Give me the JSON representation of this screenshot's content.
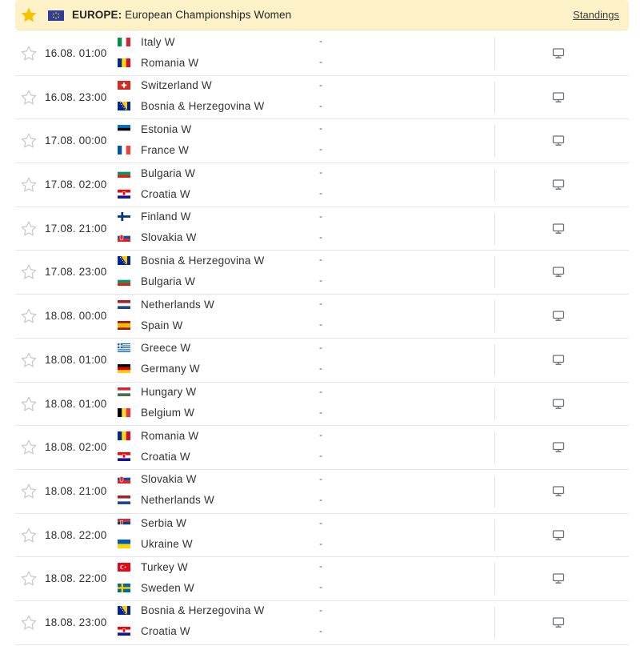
{
  "header": {
    "country": "EUROPE:",
    "league": "European Championships Women",
    "standings_label": "Standings"
  },
  "matches": [
    {
      "time": "16.08. 01:00",
      "home": {
        "name": "Italy W",
        "flag": "italy-flag"
      },
      "away": {
        "name": "Romania W",
        "flag": "romania-flag"
      },
      "home_score": "-",
      "away_score": "-"
    },
    {
      "time": "16.08. 23:00",
      "home": {
        "name": "Switzerland W",
        "flag": "switzerland-flag"
      },
      "away": {
        "name": "Bosnia & Herzegovina W",
        "flag": "bosnia-flag"
      },
      "home_score": "-",
      "away_score": "-"
    },
    {
      "time": "17.08. 00:00",
      "home": {
        "name": "Estonia W",
        "flag": "estonia-flag"
      },
      "away": {
        "name": "France W",
        "flag": "france-flag"
      },
      "home_score": "-",
      "away_score": "-"
    },
    {
      "time": "17.08. 02:00",
      "home": {
        "name": "Bulgaria W",
        "flag": "bulgaria-flag"
      },
      "away": {
        "name": "Croatia W",
        "flag": "croatia-flag"
      },
      "home_score": "-",
      "away_score": "-"
    },
    {
      "time": "17.08. 21:00",
      "home": {
        "name": "Finland W",
        "flag": "finland-flag"
      },
      "away": {
        "name": "Slovakia W",
        "flag": "slovakia-flag"
      },
      "home_score": "-",
      "away_score": "-"
    },
    {
      "time": "17.08. 23:00",
      "home": {
        "name": "Bosnia & Herzegovina W",
        "flag": "bosnia-flag"
      },
      "away": {
        "name": "Bulgaria W",
        "flag": "bulgaria-flag"
      },
      "home_score": "-",
      "away_score": "-"
    },
    {
      "time": "18.08. 00:00",
      "home": {
        "name": "Netherlands W",
        "flag": "netherlands-flag"
      },
      "away": {
        "name": "Spain W",
        "flag": "spain-flag"
      },
      "home_score": "-",
      "away_score": "-"
    },
    {
      "time": "18.08. 01:00",
      "home": {
        "name": "Greece W",
        "flag": "greece-flag"
      },
      "away": {
        "name": "Germany W",
        "flag": "germany-flag"
      },
      "home_score": "-",
      "away_score": "-"
    },
    {
      "time": "18.08. 01:00",
      "home": {
        "name": "Hungary W",
        "flag": "hungary-flag"
      },
      "away": {
        "name": "Belgium W",
        "flag": "belgium-flag"
      },
      "home_score": "-",
      "away_score": "-"
    },
    {
      "time": "18.08. 02:00",
      "home": {
        "name": "Romania W",
        "flag": "romania-flag"
      },
      "away": {
        "name": "Croatia W",
        "flag": "croatia-flag"
      },
      "home_score": "-",
      "away_score": "-"
    },
    {
      "time": "18.08. 21:00",
      "home": {
        "name": "Slovakia W",
        "flag": "slovakia-flag"
      },
      "away": {
        "name": "Netherlands W",
        "flag": "netherlands-flag"
      },
      "home_score": "-",
      "away_score": "-"
    },
    {
      "time": "18.08. 22:00",
      "home": {
        "name": "Serbia W",
        "flag": "serbia-flag"
      },
      "away": {
        "name": "Ukraine W",
        "flag": "ukraine-flag"
      },
      "home_score": "-",
      "away_score": "-"
    },
    {
      "time": "18.08. 22:00",
      "home": {
        "name": "Turkey W",
        "flag": "turkey-flag"
      },
      "away": {
        "name": "Sweden W",
        "flag": "sweden-flag"
      },
      "home_score": "-",
      "away_score": "-"
    },
    {
      "time": "18.08. 23:00",
      "home": {
        "name": "Bosnia & Herzegovina W",
        "flag": "bosnia-flag"
      },
      "away": {
        "name": "Croatia W",
        "flag": "croatia-flag"
      },
      "home_score": "-",
      "away_score": "-"
    }
  ],
  "colors": {
    "header_bg": "#fdf1c8",
    "star_active": "#f5c400",
    "star_inactive": "#c5c7c9",
    "row_divider": "#e4e6e8"
  }
}
